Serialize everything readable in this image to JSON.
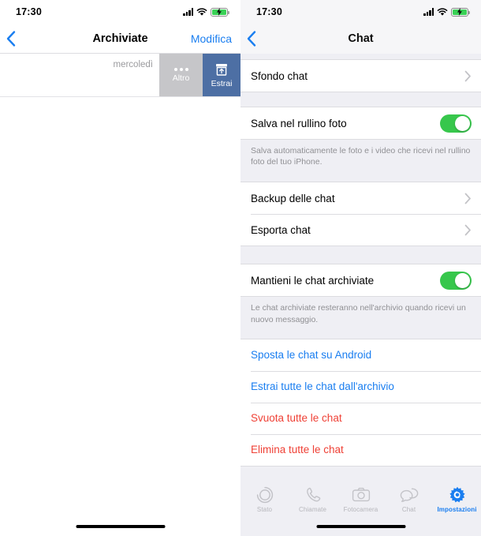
{
  "left": {
    "status": {
      "time": "17:30",
      "battery_state": "charging"
    },
    "nav": {
      "back_icon": "chevron-left-icon",
      "title": "Archiviate",
      "action": "Modifica"
    },
    "swipe_row": {
      "date": "mercoledì",
      "more": {
        "label": "Altro",
        "icon": "ellipsis-icon"
      },
      "unarchive": {
        "label": "Estrai",
        "icon": "unarchive-box-icon"
      }
    }
  },
  "right": {
    "status": {
      "time": "17:30",
      "battery_state": "charging"
    },
    "nav": {
      "back_icon": "chevron-left-icon",
      "title": "Chat"
    },
    "groups": [
      {
        "rows": [
          {
            "label": "Sfondo chat",
            "type": "disclosure"
          }
        ],
        "footnote": ""
      },
      {
        "rows": [
          {
            "label": "Salva nel rullino foto",
            "type": "toggle",
            "value": true
          }
        ],
        "footnote": "Salva automaticamente le foto e i video che ricevi nel rullino foto del tuo iPhone."
      },
      {
        "rows": [
          {
            "label": "Backup delle chat",
            "type": "disclosure"
          },
          {
            "label": "Esporta chat",
            "type": "disclosure"
          }
        ],
        "footnote": ""
      },
      {
        "rows": [
          {
            "label": "Mantieni le chat archiviate",
            "type": "toggle",
            "value": true
          }
        ],
        "footnote": "Le chat archiviate resteranno nell'archivio quando ricevi un nuovo messaggio."
      },
      {
        "rows": [
          {
            "label": "Sposta le chat su Android",
            "type": "link"
          },
          {
            "label": "Estrai tutte le chat dall'archivio",
            "type": "link"
          },
          {
            "label": "Svuota tutte le chat",
            "type": "destructive"
          },
          {
            "label": "Elimina tutte le chat",
            "type": "destructive"
          }
        ],
        "footnote": ""
      }
    ],
    "tabs": [
      {
        "label": "Stato",
        "icon": "status-rings-icon",
        "active": false
      },
      {
        "label": "Chiamate",
        "icon": "phone-icon",
        "active": false
      },
      {
        "label": "Fotocamera",
        "icon": "camera-icon",
        "active": false
      },
      {
        "label": "Chat",
        "icon": "chat-bubbles-icon",
        "active": false
      },
      {
        "label": "Impostazioni",
        "icon": "gear-icon",
        "active": true
      }
    ]
  },
  "colors": {
    "accent_blue": "#1a7ef0",
    "destructive_red": "#ef4136",
    "toggle_green": "#37c74c",
    "unarchive_blue": "#4d6fa4",
    "more_gray": "#c6c6c9",
    "group_bg": "#efeff4"
  }
}
